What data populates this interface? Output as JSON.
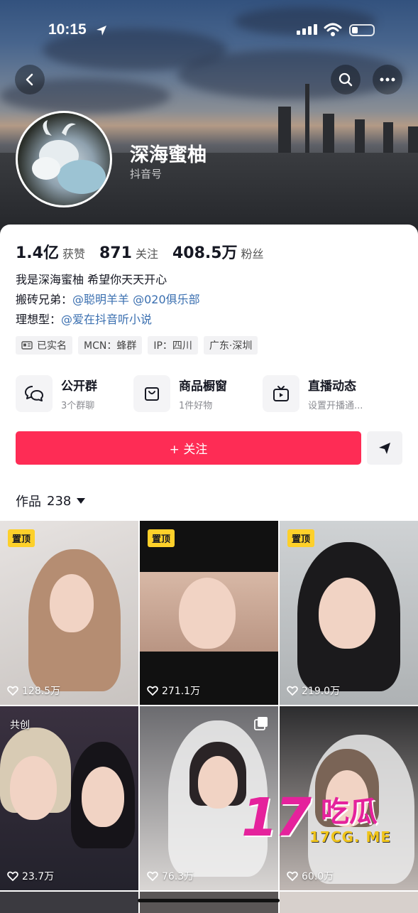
{
  "status_bar": {
    "time": "10:15"
  },
  "profile": {
    "nickname": "深海蜜柚",
    "douyin_id_label": "抖音号",
    "stats": [
      {
        "value": "1.4亿",
        "label": "获赞"
      },
      {
        "value": "871",
        "label": "关注"
      },
      {
        "value": "408.5万",
        "label": "粉丝"
      }
    ],
    "bio": {
      "line1": "我是深海蜜柚 希望你天天开心",
      "line2_prefix": "搬砖兄弟：",
      "line2_link1": "@聪明羊羊",
      "line2_link2": "@020俱乐部",
      "line3_prefix": "理想型：",
      "line3_link": "@爱在抖音听小说"
    },
    "tags": [
      "已实名",
      "MCN：蜂群",
      "IP：四川",
      "广东·深圳"
    ]
  },
  "features": [
    {
      "title": "公开群",
      "subtitle": "3个群聊",
      "icon": "chat-bubbles-icon"
    },
    {
      "title": "商品橱窗",
      "subtitle": "1件好物",
      "icon": "shopping-bag-icon"
    },
    {
      "title": "直播动态",
      "subtitle": "设置开播通...",
      "icon": "tv-icon"
    }
  ],
  "actions": {
    "follow_label": "+ 关注"
  },
  "works": {
    "label": "作品",
    "count": "238"
  },
  "videos": [
    {
      "badge": "置顶",
      "likes": "128.5万"
    },
    {
      "badge": "置顶",
      "likes": "271.1万"
    },
    {
      "badge": "置顶",
      "likes": "219.0万"
    },
    {
      "badge": "共创",
      "likes": "23.7万"
    },
    {
      "badge": "",
      "likes": "76.3万"
    },
    {
      "badge": "",
      "likes": "60.0万"
    }
  ],
  "watermark": {
    "big": "17",
    "cn": "吃瓜",
    "url": "17CG. ME"
  },
  "colors": {
    "accent": "#fe2c55",
    "link": "#3a6fb0",
    "pin": "#fdd02a",
    "watermark": "#e5229c"
  }
}
